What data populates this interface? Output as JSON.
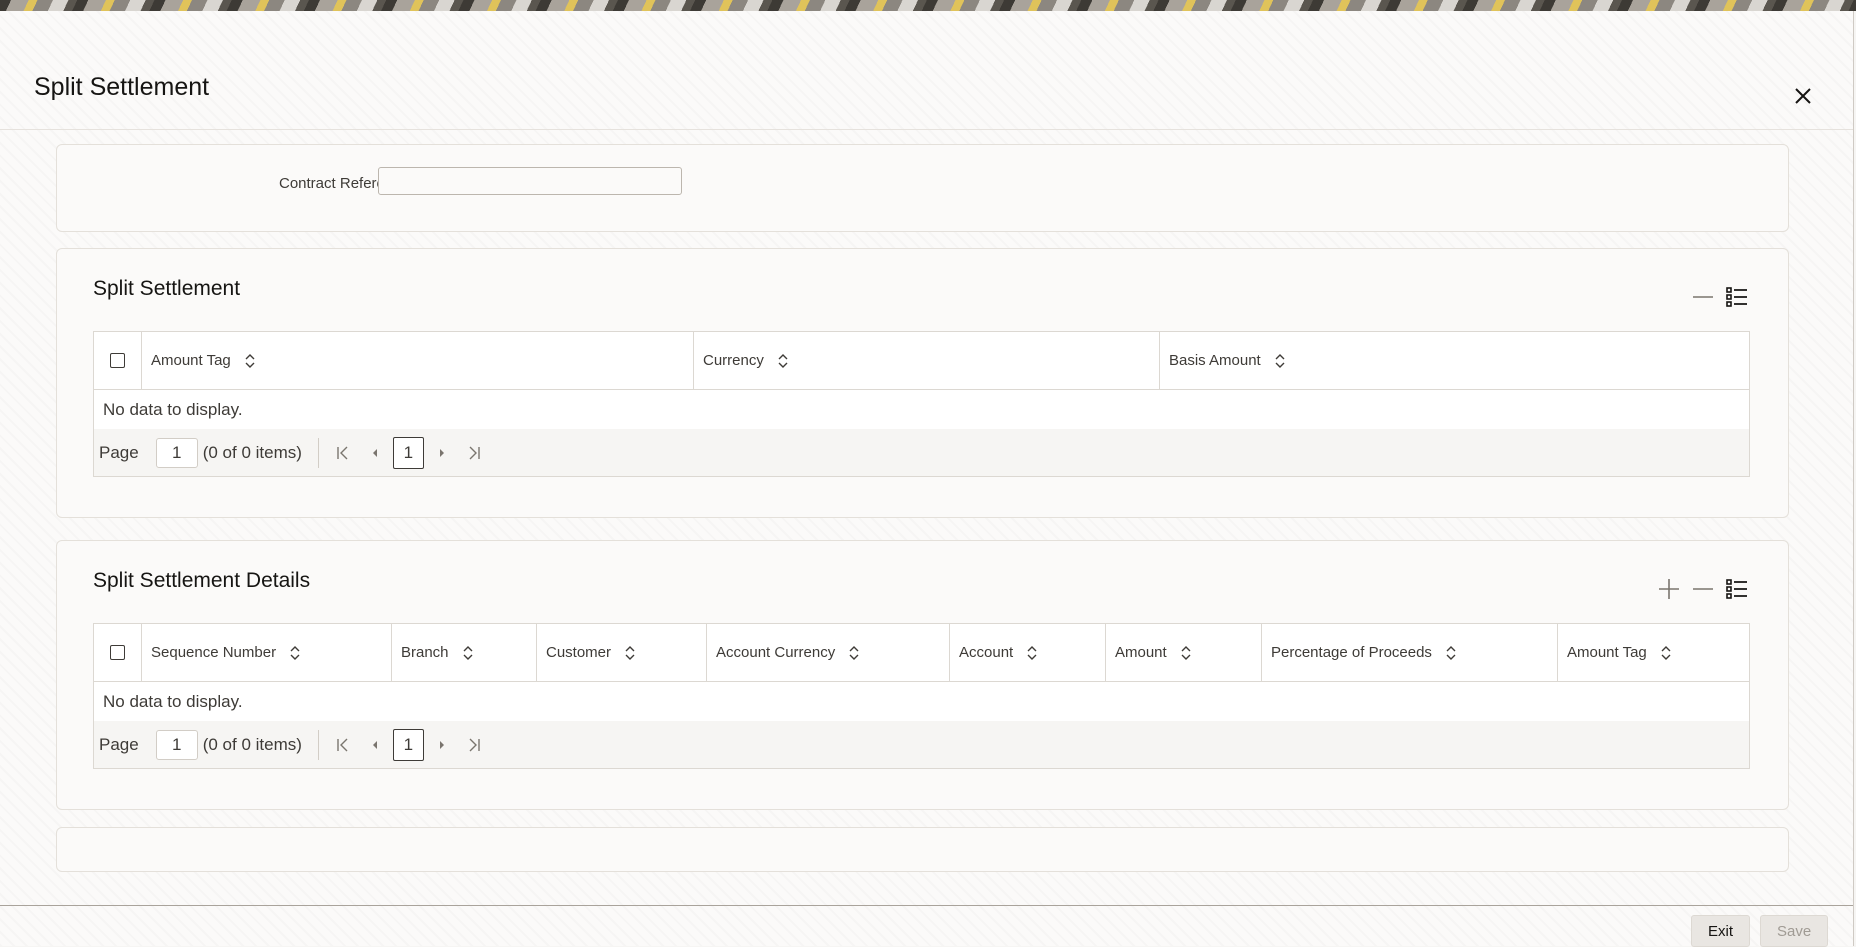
{
  "dialog": {
    "title": "Split Settlement"
  },
  "contract": {
    "label": "Contract Reference",
    "value": ""
  },
  "split_settlement": {
    "title": "Split Settlement",
    "columns": [
      "Amount Tag",
      "Currency",
      "Basis Amount"
    ],
    "empty_text": "No data to display.",
    "pager": {
      "label": "Page",
      "page": "1",
      "items_text": "(0 of 0 items)",
      "current": "1"
    }
  },
  "split_details": {
    "title": "Split Settlement Details",
    "columns": [
      "Sequence Number",
      "Branch",
      "Customer",
      "Account Currency",
      "Account",
      "Amount",
      "Percentage of Proceeds",
      "Amount Tag"
    ],
    "empty_text": "No data to display.",
    "pager": {
      "label": "Page",
      "page": "1",
      "items_text": "(0 of 0 items)",
      "current": "1"
    }
  },
  "footer": {
    "exit_label": "Exit",
    "save_label": "Save"
  },
  "colors": {
    "text": "#161513",
    "border": "#dcd8d2",
    "disabled": "#a09b94",
    "background": "#fbfaf9"
  },
  "icons": [
    "close-icon",
    "minus-icon",
    "plus-icon",
    "column-list-icon",
    "sort-icon",
    "first-page-icon",
    "prev-page-icon",
    "next-page-icon",
    "last-page-icon"
  ]
}
